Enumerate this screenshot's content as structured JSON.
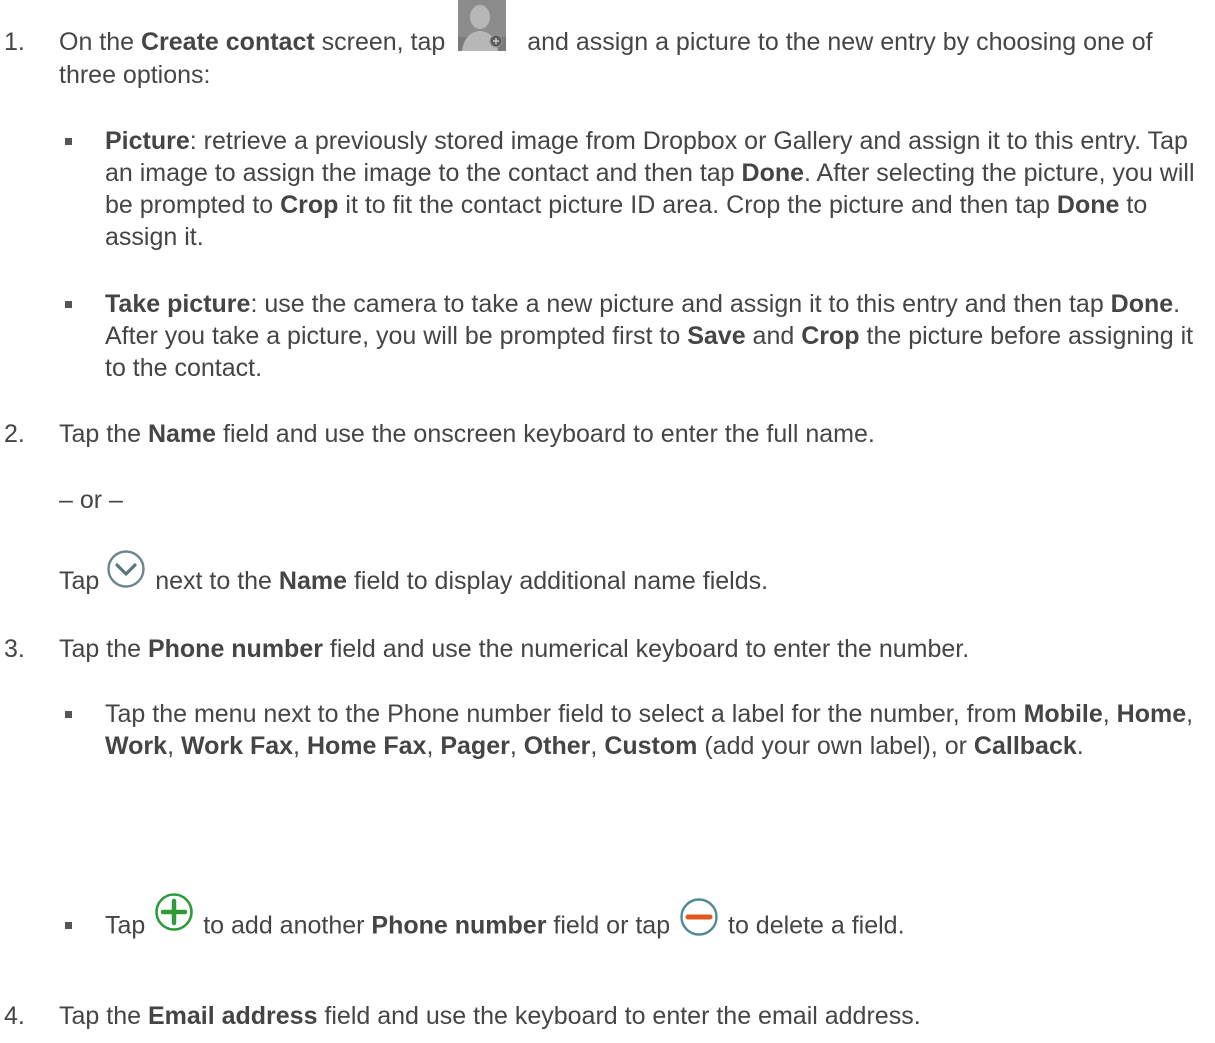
{
  "steps": {
    "s1": {
      "num": "1.",
      "t1": "On the ",
      "b1": "Create contact",
      "t2": " screen, tap ",
      "t3": " and assign a picture to the new entry by choosing one of three options:",
      "icon": "contact-picture-icon"
    },
    "s1_b1": {
      "b1": "Picture",
      "t1": ": retrieve a previously stored image from Dropbox or Gallery and assign it to this entry. Tap an image to assign the image to the contact and then tap ",
      "b2": "Done",
      "t2": ". After selecting the picture, you will be prompted to ",
      "b3": "Crop",
      "t3": " it to fit the contact picture ID area. Crop the picture and then tap ",
      "b4": "Done",
      "t4": " to assign it."
    },
    "s1_b2": {
      "b1": "Take picture",
      "t1": ": use the camera to take a new picture and assign it to this entry and then tap ",
      "b2": "Done",
      "t2": ". After you take a picture, you will be prompted first to ",
      "b3": "Save",
      "t3": " and ",
      "b4": "Crop",
      "t4": " the picture before assigning it to the contact."
    },
    "s2": {
      "num": "2.",
      "t1": "Tap the ",
      "b1": "Name",
      "t2": " field and use the onscreen keyboard to enter the full name."
    },
    "s2_or": {
      "t1": "– or –"
    },
    "s2_alt": {
      "t1": "Tap ",
      "t2": " next to the ",
      "b1": "Name",
      "t3": " field to display additional name fields.",
      "icon": "chevron-down-circle-icon"
    },
    "s3": {
      "num": "3.",
      "t1": "Tap the ",
      "b1": "Phone number",
      "t2": " field and use the numerical keyboard to enter the number."
    },
    "s3_b1": {
      "t1": "Tap the menu next to the Phone number field to select a label for the number, from ",
      "b1": "Mobile",
      "c1": ", ",
      "b2": "Home",
      "c2": ", ",
      "b3": "Work",
      "c3": ", ",
      "b4": "Work Fax",
      "c4": ", ",
      "b5": "Home Fax",
      "c5": ", ",
      "b6": "Pager",
      "c6": ", ",
      "b7": "Other",
      "c7": ", ",
      "b8": "Custom",
      "t2": " (add your own label), or ",
      "b9": "Callback",
      "t3": "."
    },
    "s3_b2": {
      "t1": "Tap ",
      "t2": " to add another ",
      "b1": "Phone number",
      "t3": " field or tap ",
      "t4": " to delete a field.",
      "icon_add": "plus-circle-icon",
      "icon_del": "minus-circle-icon"
    },
    "s4": {
      "num": "4.",
      "t1": "Tap the ",
      "b1": "Email address",
      "t2": " field and use the keyboard to enter the email address."
    }
  },
  "colors": {
    "text": "#454545",
    "add_icon": "#2e9a3a",
    "delete_icon": "#e05a1e",
    "chevron_icon": "#5f7f86"
  }
}
